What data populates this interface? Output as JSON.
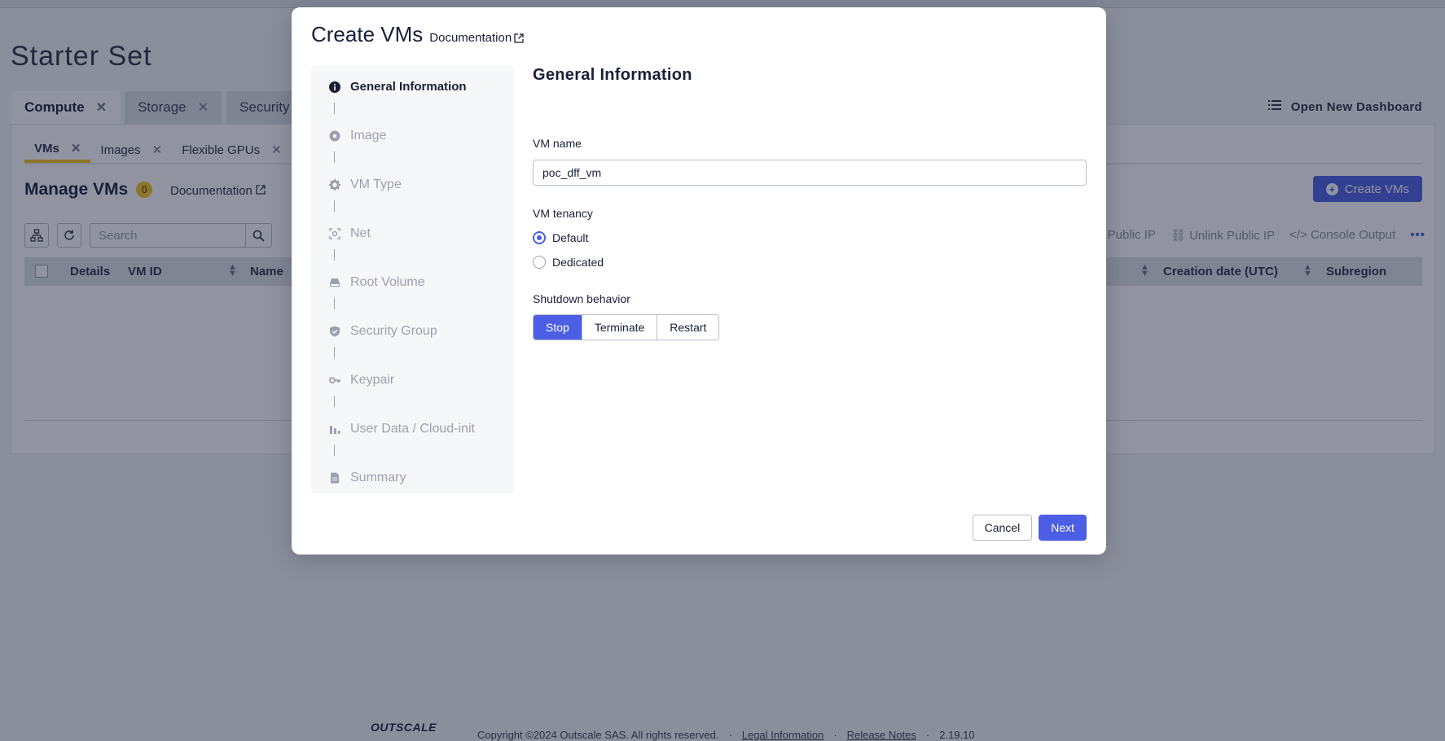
{
  "page": {
    "title": "Starter Set",
    "main_tabs": [
      {
        "label": "Compute",
        "close": "✕"
      },
      {
        "label": "Storage",
        "close": "✕"
      },
      {
        "label": "Security",
        "close": ""
      }
    ],
    "open_dashboard": "Open New Dashboard",
    "sub_tabs": [
      {
        "label": "VMs",
        "close": "✕"
      },
      {
        "label": "Images",
        "close": "✕"
      },
      {
        "label": "Flexible GPUs",
        "close": "✕"
      }
    ],
    "manage_title": "Manage VMs",
    "manage_count": "0",
    "documentation": "Documentation",
    "create_button": "Create VMs",
    "search_placeholder": "Search",
    "actions": [
      "k Public IP",
      "Unlink Public IP",
      "Console Output"
    ],
    "table_headers": {
      "details": "Details",
      "vm_id": "VM ID",
      "name": "Name",
      "creation_date": "Creation date (UTC)",
      "subregion": "Subregion"
    }
  },
  "footer": {
    "logo": "OUTSCALE",
    "copyright": "Copyright ©2024 Outscale SAS. All rights reserved.",
    "sep": "·",
    "legal": "Legal Information",
    "release": "Release Notes",
    "version": "2.19.10"
  },
  "modal": {
    "title": "Create VMs",
    "doc_link": "Documentation",
    "steps": [
      {
        "label": "General Information",
        "icon": "info-icon",
        "active": true
      },
      {
        "label": "Image",
        "icon": "disc-icon",
        "active": false
      },
      {
        "label": "VM Type",
        "icon": "gear-icon",
        "active": false
      },
      {
        "label": "Net",
        "icon": "network-icon",
        "active": false
      },
      {
        "label": "Root Volume",
        "icon": "drive-icon",
        "active": false
      },
      {
        "label": "Security Group",
        "icon": "shield-icon",
        "active": false
      },
      {
        "label": "Keypair",
        "icon": "key-icon",
        "active": false
      },
      {
        "label": "User Data / Cloud-init",
        "icon": "chart-icon",
        "active": false
      },
      {
        "label": "Summary",
        "icon": "document-icon",
        "active": false
      }
    ],
    "section_title": "General Information",
    "vm_name_label": "VM name",
    "vm_name_value": "poc_dff_vm",
    "tenancy_label": "VM tenancy",
    "tenancy_options": [
      "Default",
      "Dedicated"
    ],
    "tenancy_selected": "Default",
    "shutdown_label": "Shutdown behavior",
    "shutdown_options": [
      "Stop",
      "Terminate",
      "Restart"
    ],
    "shutdown_selected": "Stop",
    "cancel": "Cancel",
    "next": "Next"
  },
  "colors": {
    "accent": "#4b5ee4",
    "badge": "#f5c518",
    "overlay": "#192038"
  }
}
